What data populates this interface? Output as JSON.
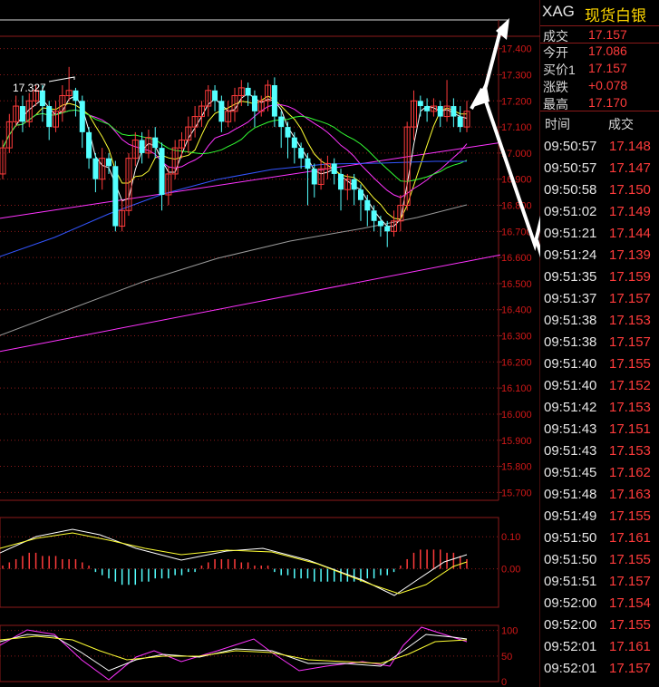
{
  "quote": {
    "symbol": "XAG",
    "name": "现货白银",
    "rows": [
      {
        "label": "成交",
        "value": "17.157"
      },
      {
        "label": "今开",
        "value": "17.086"
      },
      {
        "label": "买价1",
        "value": "17.157"
      },
      {
        "label": "涨跌",
        "value": "+0.078"
      },
      {
        "label": "最高",
        "value": "17.170"
      }
    ],
    "col_time": "时间",
    "col_price": "成交"
  },
  "ticks": [
    {
      "time": "09:50:57",
      "price": "17.148"
    },
    {
      "time": "09:50:57",
      "price": "17.147"
    },
    {
      "time": "09:50:58",
      "price": "17.150"
    },
    {
      "time": "09:51:02",
      "price": "17.149"
    },
    {
      "time": "09:51:21",
      "price": "17.144"
    },
    {
      "time": "09:51:24",
      "price": "17.139"
    },
    {
      "time": "09:51:35",
      "price": "17.159"
    },
    {
      "time": "09:51:37",
      "price": "17.157"
    },
    {
      "time": "09:51:38",
      "price": "17.153"
    },
    {
      "time": "09:51:38",
      "price": "17.157"
    },
    {
      "time": "09:51:40",
      "price": "17.155"
    },
    {
      "time": "09:51:40",
      "price": "17.152"
    },
    {
      "time": "09:51:42",
      "price": "17.153"
    },
    {
      "time": "09:51:43",
      "price": "17.151"
    },
    {
      "time": "09:51:43",
      "price": "17.153"
    },
    {
      "time": "09:51:45",
      "price": "17.162"
    },
    {
      "time": "09:51:48",
      "price": "17.163"
    },
    {
      "time": "09:51:49",
      "price": "17.155"
    },
    {
      "time": "09:51:50",
      "price": "17.161"
    },
    {
      "time": "09:51:50",
      "price": "17.155"
    },
    {
      "time": "09:51:51",
      "price": "17.157"
    },
    {
      "time": "09:52:00",
      "price": "17.154"
    },
    {
      "time": "09:52:00",
      "price": "17.155"
    },
    {
      "time": "09:52:01",
      "price": "17.161"
    },
    {
      "time": "09:52:01",
      "price": "17.157"
    }
  ],
  "colors": {
    "up": "#ff3b3b",
    "down": "#54ffff",
    "grid": "#8b1a1a",
    "axis_text": "#d01818",
    "ma_white": "#ffffff",
    "ma_yellow": "#ffff33",
    "ma_magenta": "#ff33ff",
    "ma_green": "#33ff33",
    "ma_blue": "#3355ff",
    "ma_gray": "#9a9a9a"
  },
  "chart_data": [
    {
      "type": "candlestick",
      "panel": "price",
      "y_ticks": [
        "17.400",
        "17.300",
        "17.200",
        "17.100",
        "17.000",
        "16.900",
        "16.800",
        "16.700",
        "16.600",
        "16.500",
        "16.400",
        "16.300",
        "16.200",
        "16.100",
        "16.000",
        "15.900",
        "15.800",
        "15.700"
      ],
      "ylim": [
        15.67,
        17.51
      ],
      "annotation": "17.327",
      "candles": [
        [
          16.92,
          17.02,
          16.9,
          17.05
        ],
        [
          17.02,
          17.12,
          17.0,
          17.15
        ],
        [
          17.12,
          17.18,
          17.1,
          17.22
        ],
        [
          17.18,
          17.12,
          17.08,
          17.22
        ],
        [
          17.12,
          17.2,
          17.1,
          17.23
        ],
        [
          17.2,
          17.24,
          17.18,
          17.26
        ],
        [
          17.24,
          17.18,
          17.12,
          17.26
        ],
        [
          17.18,
          17.1,
          17.05,
          17.2
        ],
        [
          17.1,
          17.16,
          17.08,
          17.2
        ],
        [
          17.16,
          17.22,
          17.12,
          17.26
        ],
        [
          17.22,
          17.24,
          17.2,
          17.33
        ],
        [
          17.24,
          17.2,
          17.14,
          17.25
        ],
        [
          17.2,
          17.08,
          17.02,
          17.22
        ],
        [
          17.08,
          16.98,
          16.94,
          17.1
        ],
        [
          16.98,
          16.9,
          16.85,
          17.0
        ],
        [
          16.9,
          16.98,
          16.86,
          17.02
        ],
        [
          16.98,
          16.95,
          16.92,
          17.0
        ],
        [
          16.95,
          16.72,
          16.7,
          16.97
        ],
        [
          16.72,
          16.78,
          16.7,
          16.82
        ],
        [
          16.78,
          16.98,
          16.76,
          17.0
        ],
        [
          16.98,
          17.05,
          16.95,
          17.08
        ],
        [
          17.05,
          17.0,
          16.96,
          17.08
        ],
        [
          17.0,
          17.06,
          16.98,
          17.09
        ],
        [
          17.06,
          17.02,
          16.98,
          17.1
        ],
        [
          17.02,
          16.84,
          16.78,
          17.04
        ],
        [
          16.84,
          16.92,
          16.8,
          16.95
        ],
        [
          16.92,
          17.02,
          16.9,
          17.05
        ],
        [
          17.02,
          17.05,
          16.98,
          17.08
        ],
        [
          17.05,
          17.1,
          17.0,
          17.14
        ],
        [
          17.1,
          17.14,
          17.06,
          17.18
        ],
        [
          17.14,
          17.18,
          17.1,
          17.2
        ],
        [
          17.18,
          17.24,
          17.14,
          17.26
        ],
        [
          17.24,
          17.2,
          17.16,
          17.26
        ],
        [
          17.2,
          17.12,
          17.08,
          17.22
        ],
        [
          17.12,
          17.16,
          17.1,
          17.2
        ],
        [
          17.16,
          17.22,
          17.12,
          17.25
        ],
        [
          17.22,
          17.25,
          17.18,
          17.28
        ],
        [
          17.25,
          17.22,
          17.18,
          17.27
        ],
        [
          17.22,
          17.16,
          17.1,
          17.24
        ],
        [
          17.16,
          17.2,
          17.14,
          17.22
        ],
        [
          17.2,
          17.26,
          17.16,
          17.28
        ],
        [
          17.26,
          17.14,
          17.1,
          17.29
        ],
        [
          17.14,
          17.1,
          17.02,
          17.16
        ],
        [
          17.1,
          17.06,
          16.98,
          17.12
        ],
        [
          17.06,
          17.02,
          16.96,
          17.08
        ],
        [
          17.02,
          16.98,
          16.94,
          17.04
        ],
        [
          16.98,
          16.94,
          16.8,
          17.0
        ],
        [
          16.94,
          16.88,
          16.83,
          16.96
        ],
        [
          16.88,
          16.94,
          16.86,
          16.98
        ],
        [
          16.94,
          16.96,
          16.9,
          16.99
        ],
        [
          16.96,
          16.92,
          16.88,
          16.98
        ],
        [
          16.92,
          16.86,
          16.78,
          16.94
        ],
        [
          16.86,
          16.9,
          16.82,
          16.92
        ],
        [
          16.9,
          16.86,
          16.8,
          16.92
        ],
        [
          16.86,
          16.82,
          16.74,
          16.88
        ],
        [
          16.82,
          16.78,
          16.72,
          16.84
        ],
        [
          16.78,
          16.74,
          16.7,
          16.8
        ],
        [
          16.74,
          16.72,
          16.68,
          16.76
        ],
        [
          16.72,
          16.7,
          16.64,
          16.74
        ],
        [
          16.7,
          16.74,
          16.68,
          16.78
        ],
        [
          16.74,
          16.8,
          16.7,
          16.84
        ],
        [
          16.8,
          17.1,
          16.78,
          17.12
        ],
        [
          17.1,
          17.2,
          17.05,
          17.24
        ],
        [
          17.2,
          17.18,
          17.14,
          17.22
        ],
        [
          17.18,
          17.16,
          17.12,
          17.21
        ],
        [
          17.16,
          17.18,
          17.14,
          17.21
        ],
        [
          17.18,
          17.14,
          17.1,
          17.2
        ],
        [
          17.14,
          17.18,
          17.12,
          17.28
        ],
        [
          17.18,
          17.14,
          17.1,
          17.21
        ],
        [
          17.14,
          17.1,
          17.08,
          17.18
        ],
        [
          17.1,
          17.16,
          17.08,
          17.2
        ]
      ],
      "trendlines": [
        {
          "color": "magenta",
          "from": [
            0,
            16.75
          ],
          "to": [
            80,
            17.04
          ]
        },
        {
          "color": "magenta",
          "from": [
            0,
            16.24
          ],
          "to": [
            80,
            16.61
          ]
        }
      ]
    },
    {
      "type": "bar",
      "panel": "macd",
      "y_ticks": [
        "0.10",
        "0.00"
      ],
      "ylim": [
        -0.12,
        0.16
      ]
    },
    {
      "type": "line",
      "panel": "kdj",
      "y_ticks": [
        "100",
        "50",
        "0"
      ],
      "ylim": [
        0,
        110
      ]
    }
  ]
}
